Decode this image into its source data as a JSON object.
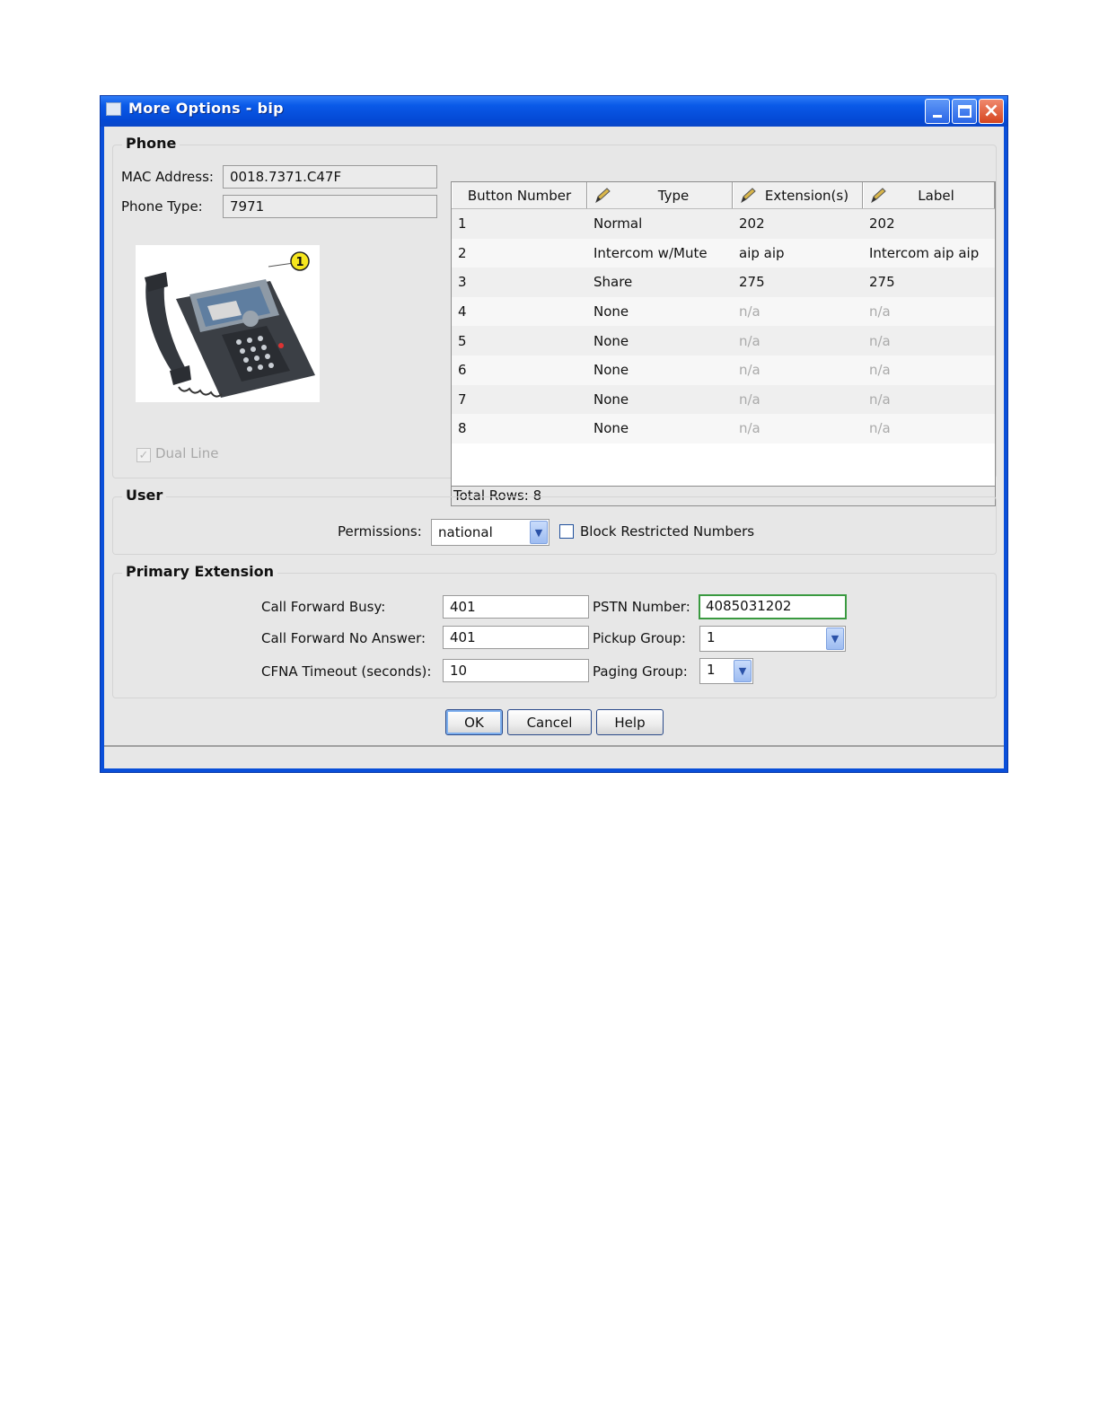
{
  "window": {
    "title": "More Options - bip"
  },
  "phone_section": {
    "title": "Phone",
    "mac_label": "MAC Address:",
    "mac_value": "0018.7371.C47F",
    "type_label": "Phone Type:",
    "type_value": "7971",
    "callout_number": "1",
    "dual_line_label": "Dual Line",
    "dual_line_checked": true,
    "grid": {
      "headers": [
        "Button Number",
        "Type",
        "Extension(s)",
        "Label"
      ],
      "rows": [
        [
          "1",
          "Normal",
          "202",
          "202"
        ],
        [
          "2",
          "Intercom w/Mute",
          "aip aip",
          "Intercom aip aip"
        ],
        [
          "3",
          "Share",
          "275",
          "275"
        ],
        [
          "4",
          "None",
          "n/a",
          "n/a"
        ],
        [
          "5",
          "None",
          "n/a",
          "n/a"
        ],
        [
          "6",
          "None",
          "n/a",
          "n/a"
        ],
        [
          "7",
          "None",
          "n/a",
          "n/a"
        ],
        [
          "8",
          "None",
          "n/a",
          "n/a"
        ]
      ],
      "footer": "Total Rows: 8"
    }
  },
  "user_section": {
    "title": "User",
    "permissions_label": "Permissions:",
    "permissions_value": "national",
    "block_label": "Block Restricted Numbers",
    "block_checked": false
  },
  "extension_section": {
    "title": "Primary Extension",
    "cfb_label": "Call Forward Busy:",
    "cfb_value": "401",
    "cfna_label": "Call Forward No Answer:",
    "cfna_value": "401",
    "timeout_label": "CFNA Timeout (seconds):",
    "timeout_value": "10",
    "pstn_label": "PSTN Number:",
    "pstn_value": "4085031202",
    "pickup_label": "Pickup Group:",
    "pickup_value": "1",
    "paging_label": "Paging Group:",
    "paging_value": "1"
  },
  "buttons": {
    "ok": "OK",
    "cancel": "Cancel",
    "help": "Help"
  },
  "colors": {
    "title_bar": "#0a4fd9",
    "client_bg": "#e7e7e7",
    "focus_border": "#3a9a40"
  }
}
